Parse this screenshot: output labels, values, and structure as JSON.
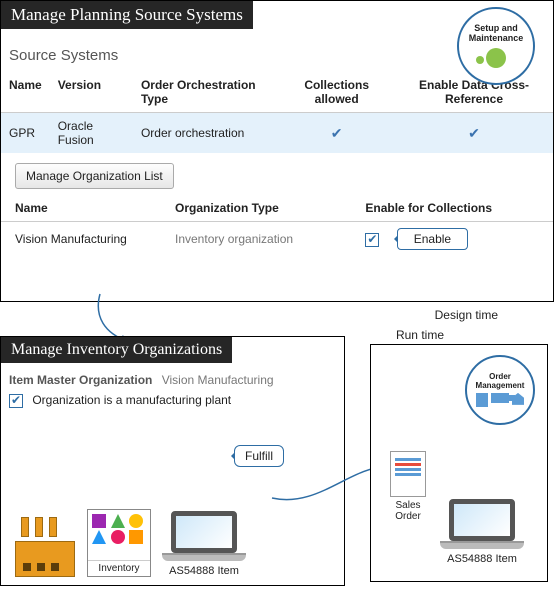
{
  "panel1": {
    "title": "Manage Planning Source Systems",
    "badge": "Setup and Maintenance",
    "subtitle": "Source Systems",
    "columns": [
      "Name",
      "Version",
      "Order Orchestration Type",
      "Collections allowed",
      "Enable Data Cross-Reference"
    ],
    "row": {
      "name": "GPR",
      "version": "Oracle Fusion",
      "oot": "Order orchestration",
      "collections": "✔",
      "cross": "✔"
    },
    "button": "Manage Organization List",
    "subcolumns": [
      "Name",
      "Organization Type",
      "Enable for Collections"
    ],
    "subrow": {
      "name": "Vision Manufacturing",
      "type": "Inventory organization",
      "enable_checked": true
    },
    "enable_callout": "Enable"
  },
  "panel2": {
    "title": "Manage Inventory Organizations",
    "master_label": "Item Master Organization",
    "master_value": "Vision Manufacturing",
    "plant_checked": true,
    "plant_label": "Organization  is a manufacturing  plant",
    "fulfill": "Fulfill",
    "inventory_label": "Inventory",
    "item_label": "AS54888 Item"
  },
  "runtime": {
    "design_label": "Design time",
    "run_label": "Run time",
    "om_badge": "Order Management",
    "sales_label": "Sales Order",
    "item_label": "AS54888 Item"
  }
}
